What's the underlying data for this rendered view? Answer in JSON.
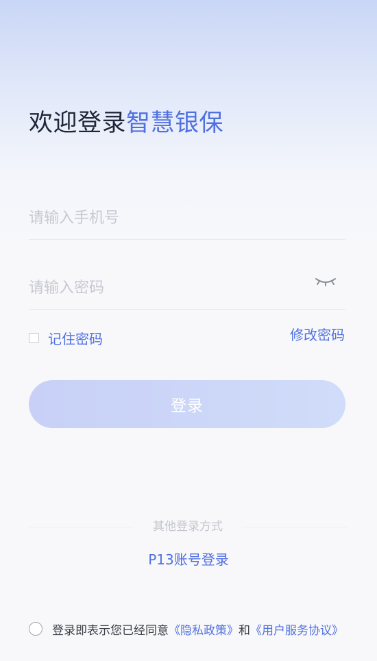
{
  "header": {
    "welcome": "欢迎登录",
    "app_name": "智慧银保"
  },
  "form": {
    "phone_placeholder": "请输入手机号",
    "password_placeholder": "请输入密码",
    "password_toggle_icon": "eye-closed-icon",
    "remember_label": "记住密码",
    "change_password": "修改密码",
    "login_button": "登录"
  },
  "alt_login": {
    "divider_text": "其他登录方式",
    "p13_login": "P13账号登录"
  },
  "agreement": {
    "prefix": "登录即表示您已经同意",
    "privacy_policy": "《隐私政策》",
    "conjunction": "和",
    "user_agreement": "《用户服务协议》"
  },
  "colors": {
    "accent": "#4f70e0",
    "title": "#1f2638",
    "button_start": "#c8d0f7",
    "button_end": "#d0dcf9",
    "placeholder": "#c6c9d1"
  }
}
